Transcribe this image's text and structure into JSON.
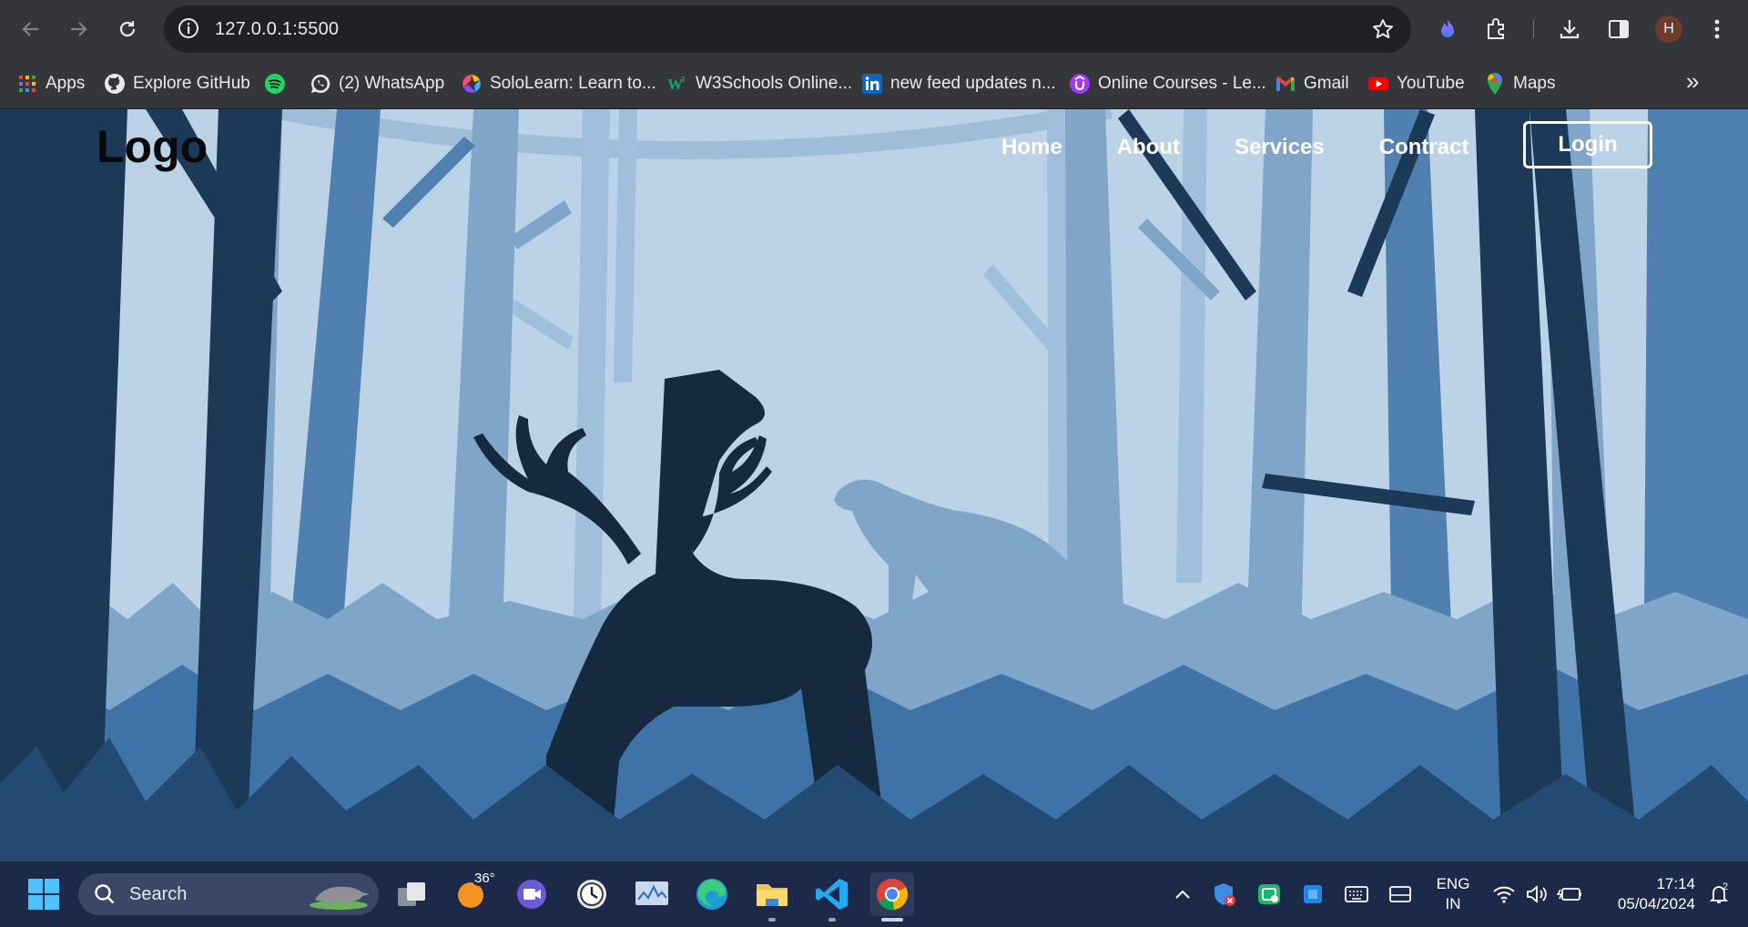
{
  "browser": {
    "url": "127.0.0.1:5500",
    "avatar_initial": "H",
    "bookmarks": [
      {
        "label": "Apps",
        "icon": "apps-grid-icon"
      },
      {
        "label": "Explore GitHub",
        "icon": "github-icon"
      },
      {
        "label": "",
        "icon": "spotify-icon"
      },
      {
        "label": "(2) WhatsApp",
        "icon": "whatsapp-icon"
      },
      {
        "label": "SoloLearn: Learn to...",
        "icon": "sololearn-icon"
      },
      {
        "label": "W3Schools Online...",
        "icon": "w3schools-icon"
      },
      {
        "label": "new feed updates n...",
        "icon": "linkedin-icon"
      },
      {
        "label": "Online Courses - Le...",
        "icon": "udemy-icon"
      },
      {
        "label": "Gmail",
        "icon": "gmail-icon"
      },
      {
        "label": "YouTube",
        "icon": "youtube-icon"
      },
      {
        "label": "Maps",
        "icon": "maps-icon"
      }
    ],
    "more_bookmarks": "»"
  },
  "site": {
    "logo": "Logo",
    "nav": [
      "Home",
      "About",
      "Services",
      "Contract"
    ],
    "login": "Login"
  },
  "taskbar": {
    "search_placeholder": "Search",
    "weather_temp": "36°",
    "language_line1": "ENG",
    "language_line2": "IN",
    "time": "17:14",
    "date": "05/04/2024",
    "notification_count": "2"
  },
  "colors": {
    "sky": "#bcd3e7",
    "far_trees": "#7fa6c9",
    "mid_trees": "#4f80b0",
    "near_trees": "#1c3a57",
    "foreground": "#152a3e",
    "accent_grass": "#3f73a8"
  }
}
